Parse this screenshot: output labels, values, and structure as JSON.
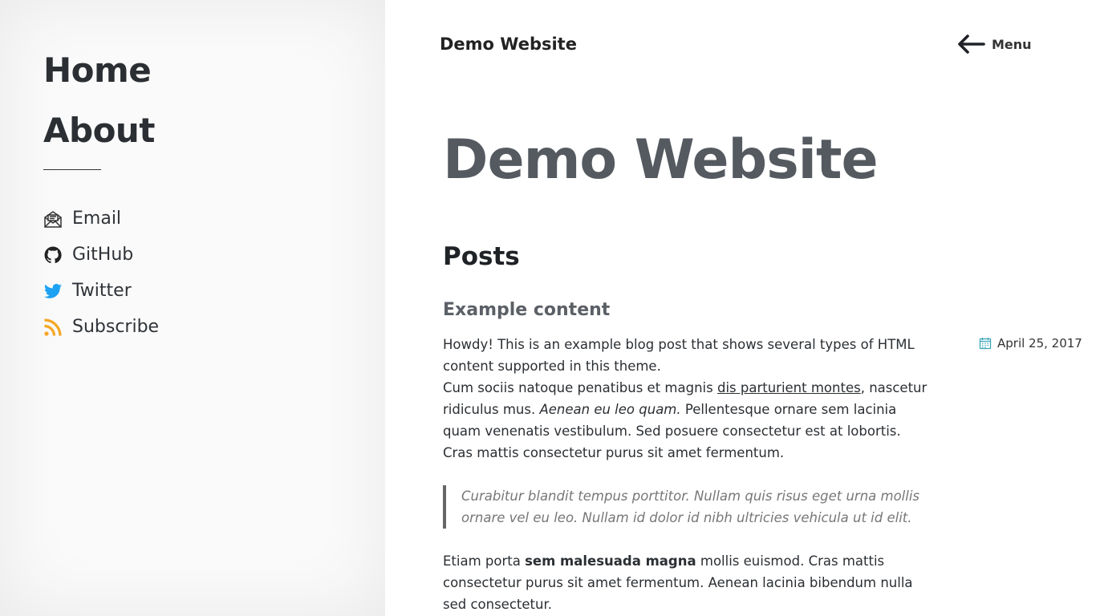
{
  "sidebar": {
    "nav": [
      {
        "label": "Home"
      },
      {
        "label": "About"
      }
    ],
    "social": [
      {
        "label": "Email",
        "icon": "email-icon"
      },
      {
        "label": "GitHub",
        "icon": "github-icon"
      },
      {
        "label": "Twitter",
        "icon": "twitter-icon",
        "color": "#1da1f2"
      },
      {
        "label": "Subscribe",
        "icon": "rss-icon",
        "color": "#f5a623"
      }
    ]
  },
  "header": {
    "site_title": "Demo Website",
    "menu_label": "Menu",
    "menu_icon": "arrow-left-icon"
  },
  "main": {
    "title": "Demo Website",
    "section_heading": "Posts",
    "post": {
      "title": "Example content",
      "date": "April 25, 2017",
      "date_icon": "calendar-icon",
      "date_icon_color": "#3aa6b9",
      "p1": "Howdy! This is an example blog post that shows several types of HTML content supported in this theme.",
      "p2_start": "Cum sociis natoque penatibus et magnis ",
      "p2_link": "dis parturient montes",
      "p2_mid": ", nascetur ridiculus mus. ",
      "p2_em": "Aenean eu leo quam.",
      "p2_end": " Pellentesque ornare sem lacinia quam venenatis vestibulum. Sed posuere consectetur est at lobortis. Cras mattis consectetur purus sit amet fermentum.",
      "quote": "Curabitur blandit tempus porttitor. Nullam quis risus eget urna mollis ornare vel eu leo. Nullam id dolor id nibh ultricies vehicula ut id elit.",
      "p3_start": "Etiam porta ",
      "p3_strong": "sem malesuada magna",
      "p3_end": " mollis euismod. Cras mattis consectetur purus sit amet fermentum. Aenean lacinia bibendum nulla sed consectetur."
    }
  }
}
